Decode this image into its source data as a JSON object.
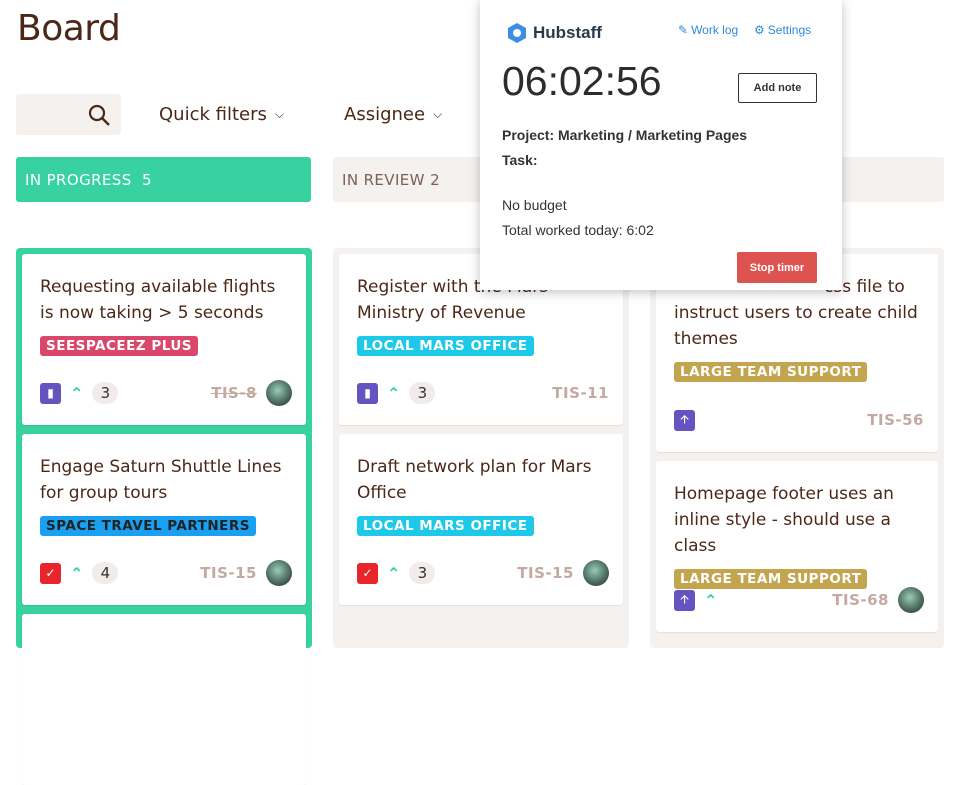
{
  "page": {
    "title": "Board"
  },
  "toolbar": {
    "quick_filters": "Quick filters",
    "assignee": "Assignee"
  },
  "columns": [
    {
      "label": "IN PROGRESS",
      "count": "5",
      "cards": [
        {
          "title": "Requesting available flights is now taking > 5 seconds",
          "tag": "SEESPACEEZ PLUS",
          "tag_color": "#d9486a",
          "type": "story",
          "count": "3",
          "key": "TIS-8",
          "done": true
        },
        {
          "title": "Engage Saturn Shuttle Lines for group tours",
          "tag": "SPACE TRAVEL PARTNERS",
          "tag_color": "#1aa0f0",
          "type": "task",
          "count": "4",
          "key": "TIS-15"
        }
      ]
    },
    {
      "label": "IN REVIEW",
      "count": "2",
      "cards": [
        {
          "title": "Register with the Mars Ministry of Revenue",
          "tag": "LOCAL MARS OFFICE",
          "tag_color": "#1ec8e8",
          "type": "story",
          "count": "3",
          "key": "TIS-11"
        },
        {
          "title": "Draft network plan for Mars Office",
          "tag": "LOCAL MARS OFFICE",
          "tag_color": "#1ec8e8",
          "type": "task",
          "count": "3",
          "key": "TIS-15"
        }
      ]
    },
    {
      "cards": [
        {
          "title": "css file to instruct users to create child themes",
          "tag": "LARGE TEAM SUPPORT",
          "tag_color": "#c2a54e",
          "type": "improvement",
          "key": "TIS-56"
        },
        {
          "title": "Homepage footer uses an inline style - should use a class",
          "tag": "LARGE TEAM SUPPORT",
          "tag_color": "#c2a54e",
          "type": "improvement",
          "key": "TIS-68"
        }
      ]
    }
  ],
  "hubstaff": {
    "brand": "Hubstaff",
    "work_log": "Work log",
    "settings": "Settings",
    "timer": "06:02:56",
    "add_note": "Add note",
    "project": "Project: Marketing / Marketing Pages",
    "task": "Task:",
    "budget": "No budget",
    "total": "Total worked today: 6:02",
    "stop": "Stop timer"
  }
}
